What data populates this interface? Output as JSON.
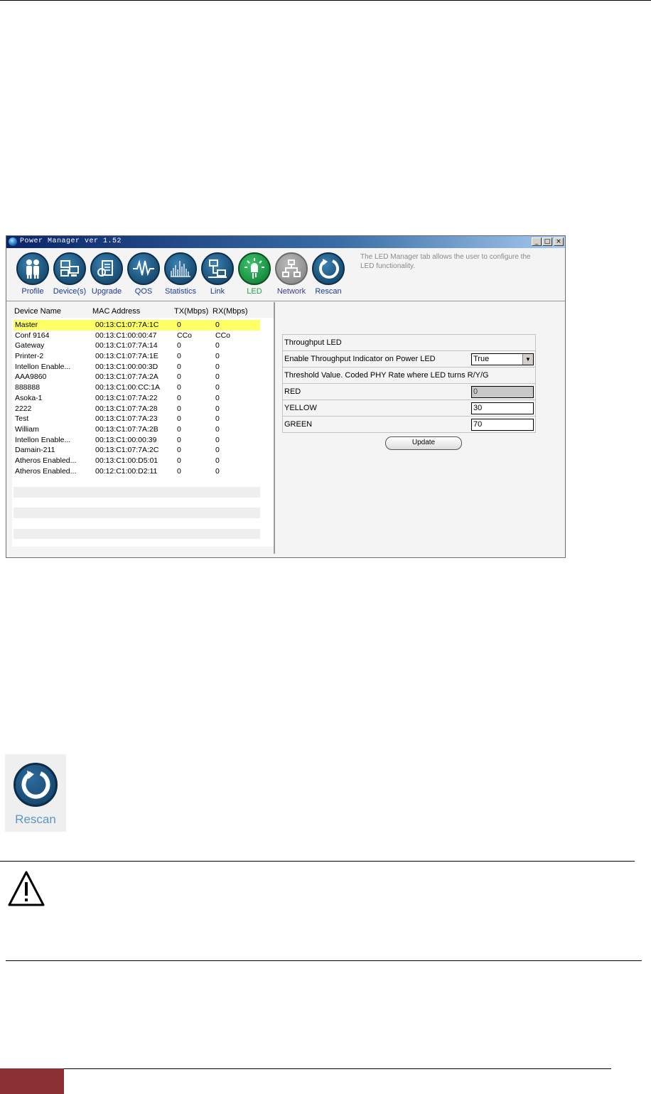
{
  "window": {
    "title": "Power Manager ver 1.52",
    "buttons": [
      "_",
      "□",
      "×"
    ]
  },
  "toolbar": {
    "items": [
      {
        "label": "Profile",
        "icon": "people-icon"
      },
      {
        "label": "Device(s)",
        "icon": "computers-icon"
      },
      {
        "label": "Upgrade",
        "icon": "upgrade-icon"
      },
      {
        "label": "QOS",
        "icon": "waveform-icon"
      },
      {
        "label": "Statistics",
        "icon": "bars-icon"
      },
      {
        "label": "Link",
        "icon": "network-link-icon"
      },
      {
        "label": "LED",
        "icon": "led-bulb-icon"
      },
      {
        "label": "Network",
        "icon": "network-tree-icon"
      },
      {
        "label": "Rescan",
        "icon": "rescan-icon"
      }
    ],
    "active": "LED",
    "description": "The LED Manager tab allows the user to configure the LED functionality."
  },
  "device_table": {
    "headers": [
      "Device Name",
      "MAC Address",
      "TX(Mbps)",
      "RX(Mbps)"
    ],
    "rows": [
      [
        "Master",
        "00:13:C1:07:7A:1C",
        "0",
        "0"
      ],
      [
        "Conf 9164",
        "00:13:C1:00:00:47",
        "CCo",
        "CCo"
      ],
      [
        "Gateway",
        "00:13:C1:07:7A:14",
        "0",
        "0"
      ],
      [
        "Printer-2",
        "00:13:C1:07:7A:1E",
        "0",
        "0"
      ],
      [
        "Intellon Enable...",
        "00:13:C1:00:00:3D",
        "0",
        "0"
      ],
      [
        "AAA9860",
        "00:13:C1:07:7A:2A",
        "0",
        "0"
      ],
      [
        "888888",
        "00:13:C1:00:CC:1A",
        "0",
        "0"
      ],
      [
        "Asoka-1",
        "00:13:C1:07:7A:22",
        "0",
        "0"
      ],
      [
        "2222",
        "00:13:C1:07:7A:28",
        "0",
        "0"
      ],
      [
        "Test",
        "00:13:C1:07:7A:23",
        "0",
        "0"
      ],
      [
        "William",
        "00:13:C1:07:7A:2B",
        "0",
        "0"
      ],
      [
        "Intellon Enable...",
        "00:13:C1:00:00:39",
        "0",
        "0"
      ],
      [
        "Damain-211",
        "00:13:C1:07:7A:2C",
        "0",
        "0"
      ],
      [
        "Atheros Enabled...",
        "00:13:C1:00:D5:01",
        "0",
        "0"
      ],
      [
        "Atheros Enabled...",
        "00:12:C1:00:D2:11",
        "0",
        "0"
      ]
    ]
  },
  "led_form": {
    "section_title": "Throughput LED",
    "enable_label": "Enable Throughput Indicator on Power LED",
    "enable_value": "True",
    "threshold_label": "Threshold Value. Coded PHY Rate where LED turns R/Y/G",
    "red_label": "RED",
    "red_value": "0",
    "yellow_label": "YELLOW",
    "yellow_value": "30",
    "green_label": "GREEN",
    "green_value": "70",
    "update_label": "Update"
  },
  "rescan_icon": {
    "label": "Rescan"
  }
}
